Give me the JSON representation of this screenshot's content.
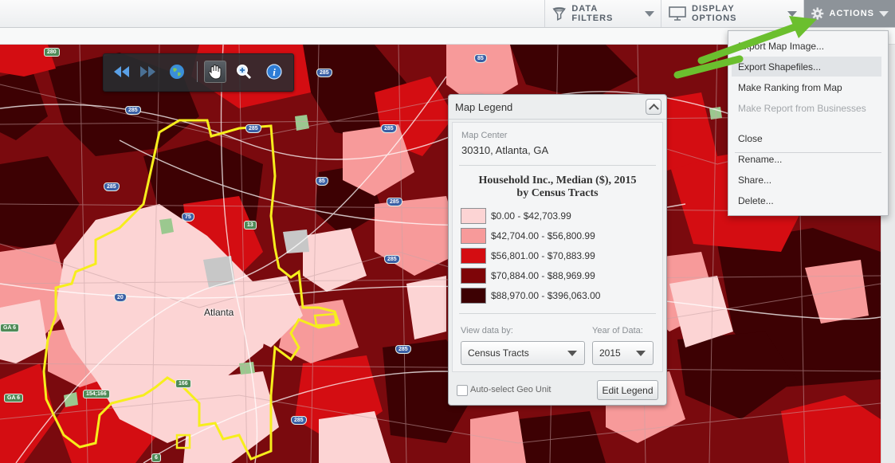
{
  "toolbar": {
    "data_filters": "DATA FILTERS",
    "display_options": "DISPLAY OPTIONS",
    "actions": "ACTIONS"
  },
  "actions_menu": {
    "items": [
      {
        "label": "Export Map Image...",
        "state": "normal"
      },
      {
        "label": "Export Shapefiles...",
        "state": "highlighted"
      },
      {
        "label": "Make Ranking from Map",
        "state": "normal"
      },
      {
        "label": "Make Report from Businesses",
        "state": "disabled"
      },
      {
        "label": "Close",
        "state": "normal"
      },
      {
        "label": "Rename...",
        "state": "normal"
      },
      {
        "label": "Share...",
        "state": "normal"
      },
      {
        "label": "Delete...",
        "state": "normal"
      }
    ]
  },
  "map": {
    "city_label": "Atlanta",
    "route_shields": [
      "280",
      "85",
      "285",
      "285",
      "285",
      "285",
      "85",
      "285",
      "75",
      "13",
      "285",
      "20",
      "154;166",
      "166",
      "285",
      "6",
      "GA 6",
      "GA 6",
      "285",
      "285"
    ]
  },
  "map_nav": {
    "icons": [
      "back-icon",
      "forward-icon",
      "globe-icon",
      "pan-hand-icon",
      "zoom-in-icon",
      "info-icon"
    ]
  },
  "legend": {
    "header": "Map Legend",
    "map_center_label": "Map Center",
    "map_center_value": "30310, Atlanta, GA",
    "title_line1": "Household Inc., Median ($), 2015",
    "title_line2": "by Census Tracts",
    "classes": [
      {
        "label": "$0.00 - $42,703.99",
        "color": "#fcd4d4"
      },
      {
        "label": "$42,704.00 - $56,800.99",
        "color": "#f79a9a"
      },
      {
        "label": "$56,801.00 - $70,883.99",
        "color": "#d40d12"
      },
      {
        "label": "$70,884.00 - $88,969.99",
        "color": "#7e0508"
      },
      {
        "label": "$88,970.00 - $396,063.00",
        "color": "#3d0103"
      }
    ],
    "view_data_by_label": "View data by:",
    "view_data_by_value": "Census Tracts",
    "year_label": "Year of Data:",
    "year_value": "2015",
    "auto_select_label": "Auto-select Geo Unit",
    "edit_button": "Edit Legend"
  },
  "colors": {
    "accent_arrow": "#6bbf2e",
    "boundary": "#f6ee1c",
    "actions_active": "#8d9399"
  }
}
